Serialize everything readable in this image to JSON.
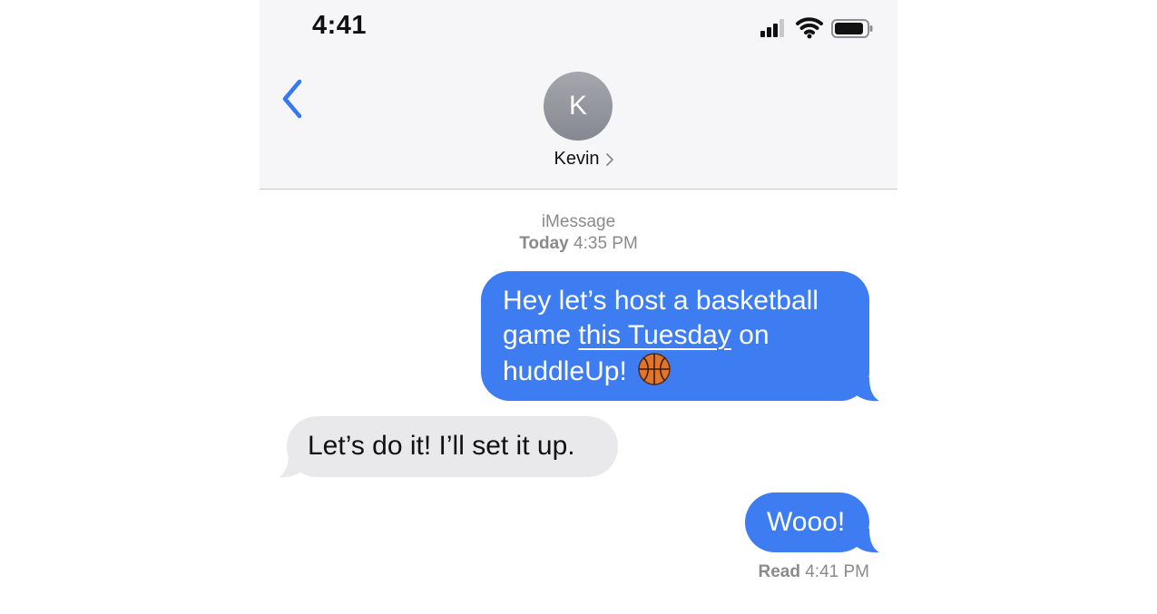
{
  "status_bar": {
    "time": "4:41",
    "icons": [
      "cellular-signal-icon",
      "wifi-icon",
      "battery-icon"
    ]
  },
  "header": {
    "back_icon": "chevron-left-icon",
    "avatar_initial": "K",
    "contact_name": "Kevin",
    "contact_chevron_icon": "chevron-right-icon"
  },
  "conversation": {
    "service": "iMessage",
    "date_label": "Today",
    "date_time": "4:35 PM",
    "messages": [
      {
        "direction": "sent",
        "text_before_link": "Hey let’s host a basketball game ",
        "link_text": "this Tuesday",
        "text_after_link": " on huddleUp!",
        "emoji": "basketball-icon"
      },
      {
        "direction": "received",
        "text": "Let’s do it! I’ll set it up."
      },
      {
        "direction": "sent",
        "text": "Wooo!"
      }
    ],
    "read_receipt": {
      "label": "Read",
      "time": "4:41 PM"
    }
  },
  "colors": {
    "sent_bubble": "#3e7cf1",
    "received_bubble": "#e9e9eb",
    "accent": "#3478f6",
    "meta_text": "#8a8a8e",
    "header_bg": "#f6f6f8"
  }
}
